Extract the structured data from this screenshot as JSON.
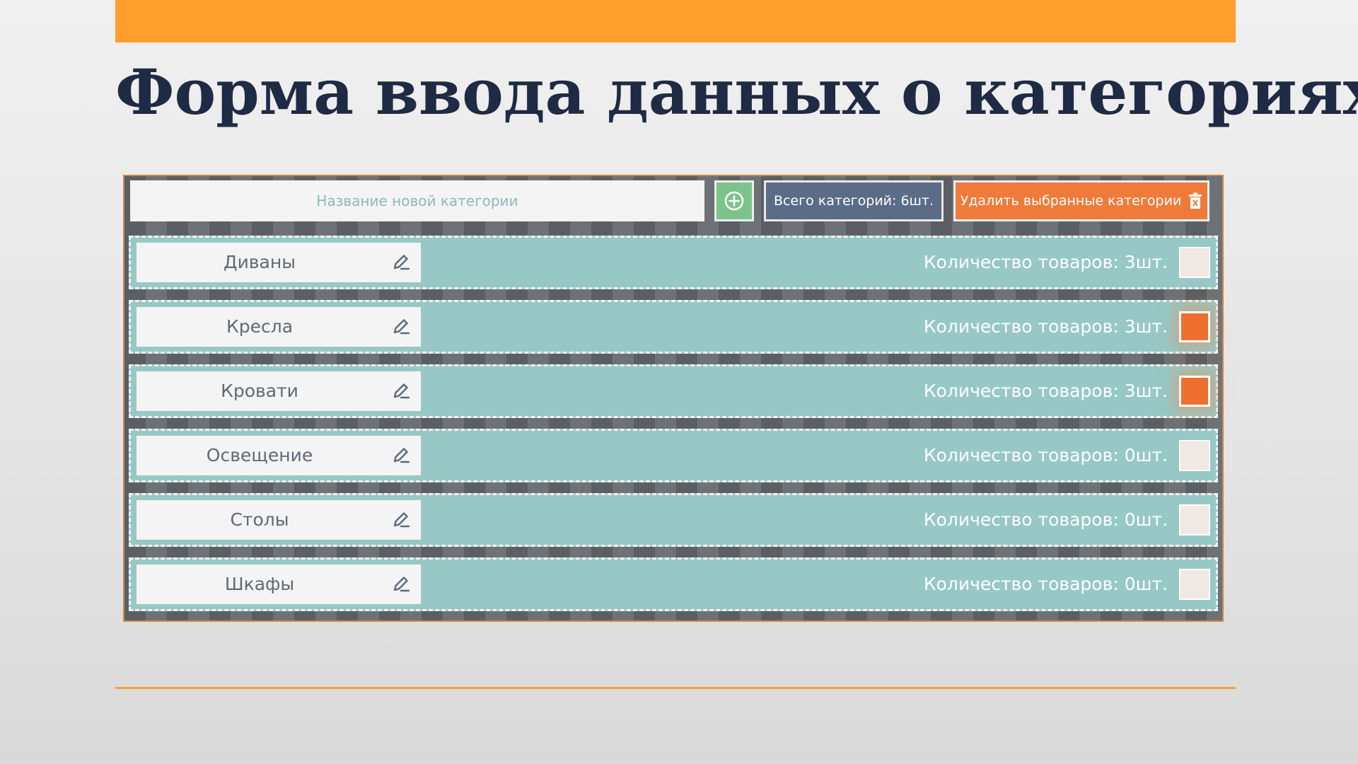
{
  "title": "Форма ввода данных о категориях",
  "toolbar": {
    "new_category_placeholder": "Название новой категории",
    "new_category_value": "",
    "total_label": "Всего категорий: 6шт.",
    "delete_label": "Удалить выбранные категории"
  },
  "categories": [
    {
      "name": "Диваны",
      "quantity": "Количество товаров: 3шт.",
      "checked": false
    },
    {
      "name": "Кресла",
      "quantity": "Количество товаров: 3шт.",
      "checked": true
    },
    {
      "name": "Кровати",
      "quantity": "Количество товаров: 3шт.",
      "checked": true
    },
    {
      "name": "Освещение",
      "quantity": "Количество товаров: 0шт.",
      "checked": false
    },
    {
      "name": "Столы",
      "quantity": "Количество товаров: 0шт.",
      "checked": false
    },
    {
      "name": "Шкафы",
      "quantity": "Количество товаров: 0шт.",
      "checked": false
    }
  ],
  "icons": {
    "add": "plus-circle-icon",
    "delete": "trash-icon",
    "edit": "pencil-icon"
  },
  "colors": {
    "accent": "#FF9E2A",
    "title": "#1F2A44",
    "row": "#97C8C6",
    "checked": "#EE6F2E",
    "add_button": "#7DC48B",
    "count_button": "#5B6C86",
    "delete_button": "#EE7B3A"
  }
}
